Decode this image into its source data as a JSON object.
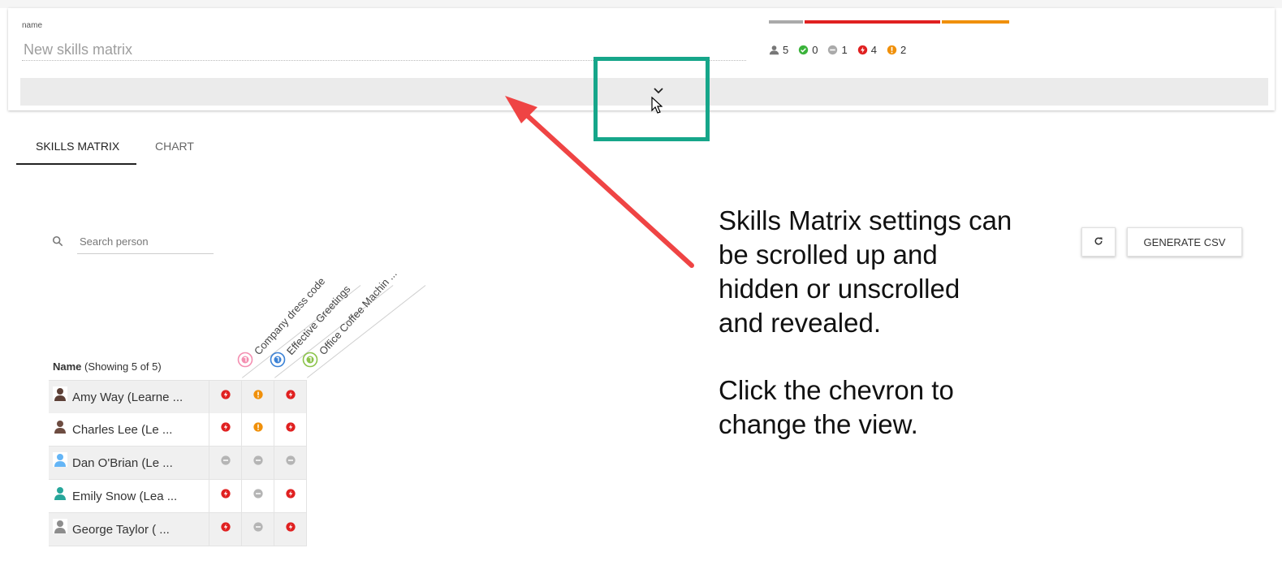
{
  "settings": {
    "name_label": "name",
    "name_placeholder": "New skills matrix",
    "stats": {
      "people": "5",
      "completed": "0",
      "not_started": "1",
      "overdue": "4",
      "due_soon": "2"
    },
    "colors": {
      "grey": "#aaaaaa",
      "red": "#e02020",
      "orange": "#f0900a",
      "green": "#3bb33b"
    }
  },
  "tabs": [
    {
      "label": "SKILLS MATRIX",
      "active": true
    },
    {
      "label": "CHART",
      "active": false
    }
  ],
  "search": {
    "placeholder": "Search person"
  },
  "toolbar": {
    "generate_csv_label": "GENERATE CSV",
    "refresh_icon": "refresh-icon"
  },
  "annotation": {
    "line1": "Skills Matrix settings can",
    "line2": "be scrolled up and",
    "line3": "hidden or unscrolled",
    "line4": "and revealed.",
    "line5": "Click the chevron to",
    "line6": "change the view."
  },
  "matrix": {
    "name_header": "Name",
    "showing": "(Showing 5 of 5)",
    "columns": [
      {
        "label": "Company dress code",
        "color": "#f48fb1"
      },
      {
        "label": "Effective Greetings",
        "color": "#3b82d6"
      },
      {
        "label": "Office Coffee Machin ...",
        "color": "#8bc34a"
      }
    ],
    "rows": [
      {
        "name": "Amy Way (Learne ...",
        "statuses": [
          "overdue",
          "due_soon",
          "overdue"
        ]
      },
      {
        "name": "Charles Lee (Le ...",
        "statuses": [
          "overdue",
          "due_soon",
          "overdue"
        ]
      },
      {
        "name": "Dan O'Brian (Le ...",
        "statuses": [
          "not_started",
          "not_started",
          "not_started"
        ]
      },
      {
        "name": "Emily Snow (Lea ...",
        "statuses": [
          "overdue",
          "not_started",
          "overdue"
        ]
      },
      {
        "name": "George Taylor ( ...",
        "statuses": [
          "overdue",
          "not_started",
          "overdue"
        ]
      }
    ]
  }
}
